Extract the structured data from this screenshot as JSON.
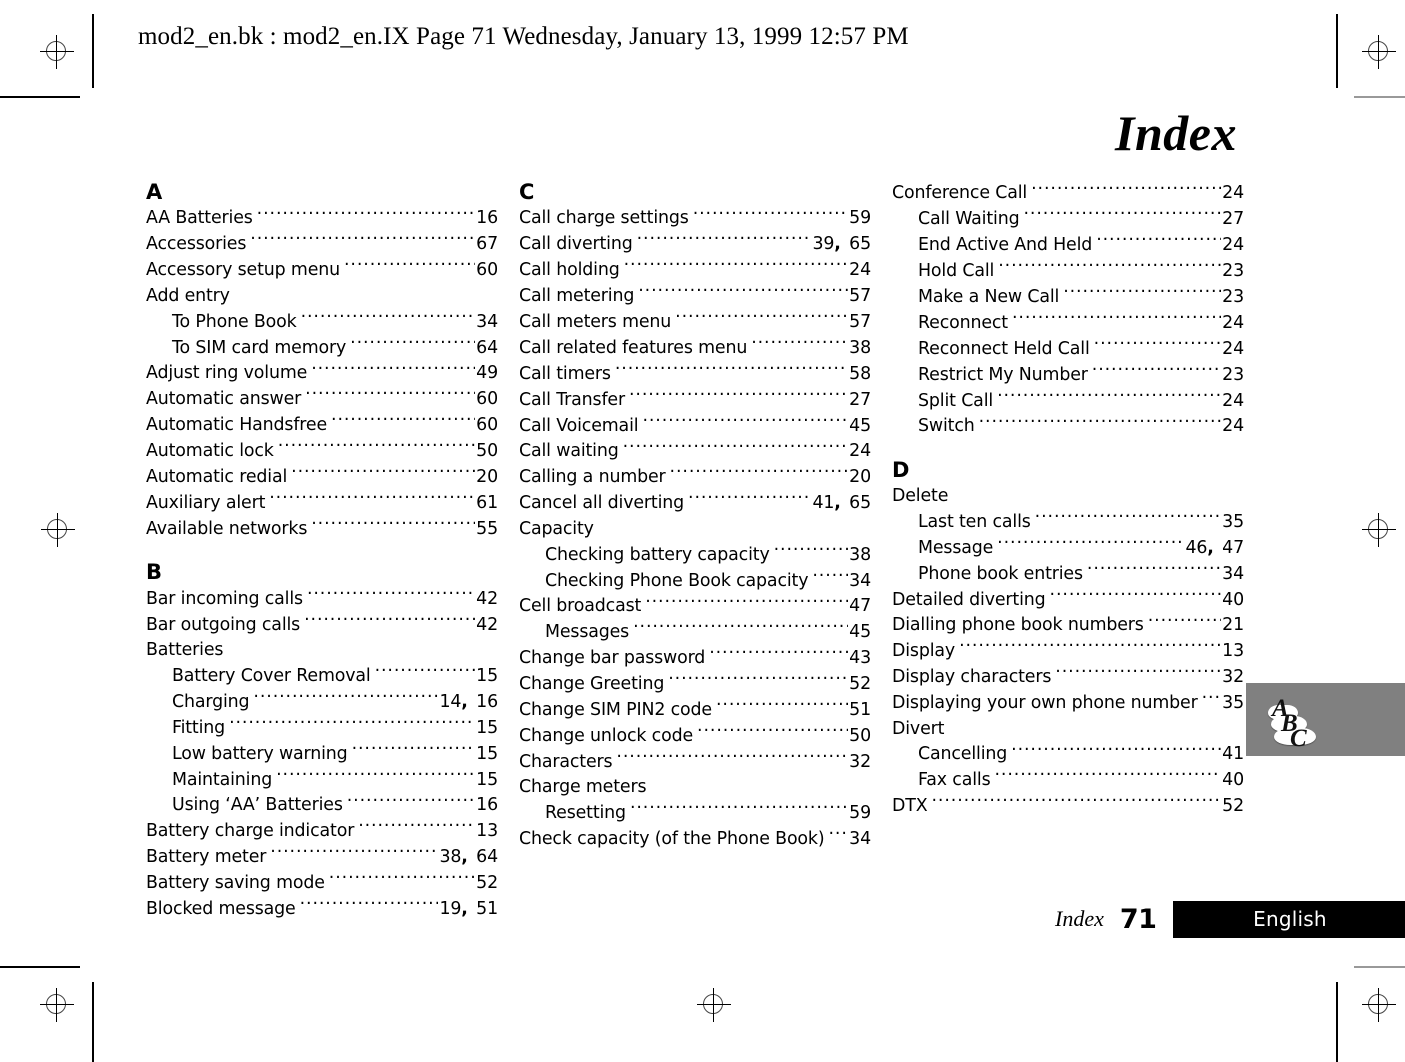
{
  "header": {
    "running_head": "mod2_en.bk : mod2_en.IX  Page 71  Wednesday, January 13, 1999  12:57 PM"
  },
  "page": {
    "title": "Index"
  },
  "columns": [
    {
      "sections": [
        {
          "letter": "A",
          "entries": [
            {
              "label": "AA Batteries",
              "pages": "16",
              "sub": false
            },
            {
              "label": "Accessories",
              "pages": "67",
              "sub": false
            },
            {
              "label": "Accessory setup menu",
              "pages": "60",
              "sub": false
            },
            {
              "label": "Add entry",
              "pages": "",
              "sub": false
            },
            {
              "label": "To Phone Book",
              "pages": "34",
              "sub": true
            },
            {
              "label": "To SIM card memory",
              "pages": "64",
              "sub": true
            },
            {
              "label": "Adjust ring volume",
              "pages": "49",
              "sub": false
            },
            {
              "label": "Automatic answer",
              "pages": "60",
              "sub": false
            },
            {
              "label": "Automatic Handsfree",
              "pages": "60",
              "sub": false
            },
            {
              "label": "Automatic lock",
              "pages": "50",
              "sub": false
            },
            {
              "label": "Automatic redial",
              "pages": "20",
              "sub": false
            },
            {
              "label": "Auxiliary alert",
              "pages": "61",
              "sub": false
            },
            {
              "label": "Available networks",
              "pages": "55",
              "sub": false
            }
          ]
        },
        {
          "letter": "B",
          "entries": [
            {
              "label": "Bar incoming calls",
              "pages": "42",
              "sub": false
            },
            {
              "label": "Bar outgoing calls",
              "pages": "42",
              "sub": false
            },
            {
              "label": "Batteries",
              "pages": "",
              "sub": false
            },
            {
              "label": "Battery Cover Removal",
              "pages": "15",
              "sub": true
            },
            {
              "label": "Charging",
              "pages": "14, 16",
              "sub": true
            },
            {
              "label": "Fitting",
              "pages": "15",
              "sub": true
            },
            {
              "label": "Low battery warning",
              "pages": "15",
              "sub": true
            },
            {
              "label": "Maintaining",
              "pages": "15",
              "sub": true
            },
            {
              "label": "Using ‘AA’ Batteries",
              "pages": "16",
              "sub": true
            },
            {
              "label": "Battery charge indicator",
              "pages": "13",
              "sub": false
            },
            {
              "label": "Battery meter",
              "pages": "38, 64",
              "sub": false
            },
            {
              "label": "Battery saving mode",
              "pages": "52",
              "sub": false
            },
            {
              "label": "Blocked message",
              "pages": "19, 51",
              "sub": false
            }
          ]
        }
      ]
    },
    {
      "sections": [
        {
          "letter": "C",
          "entries": [
            {
              "label": "Call charge settings",
              "pages": "59",
              "sub": false
            },
            {
              "label": "Call diverting",
              "pages": "39, 65",
              "sub": false
            },
            {
              "label": "Call holding",
              "pages": "24",
              "sub": false
            },
            {
              "label": "Call metering",
              "pages": "57",
              "sub": false
            },
            {
              "label": "Call meters menu",
              "pages": "57",
              "sub": false
            },
            {
              "label": "Call related features menu",
              "pages": "38",
              "sub": false
            },
            {
              "label": "Call timers",
              "pages": "58",
              "sub": false
            },
            {
              "label": "Call Transfer",
              "pages": "27",
              "sub": false
            },
            {
              "label": "Call Voicemail",
              "pages": "45",
              "sub": false
            },
            {
              "label": "Call waiting",
              "pages": "24",
              "sub": false
            },
            {
              "label": "Calling a number",
              "pages": "20",
              "sub": false
            },
            {
              "label": "Cancel all diverting",
              "pages": "41, 65",
              "sub": false
            },
            {
              "label": "Capacity",
              "pages": "",
              "sub": false
            },
            {
              "label": "Checking battery capacity",
              "pages": "38",
              "sub": true
            },
            {
              "label": "Checking Phone Book capacity",
              "pages": "34",
              "sub": true
            },
            {
              "label": "Cell broadcast",
              "pages": "47",
              "sub": false
            },
            {
              "label": "Messages",
              "pages": "45",
              "sub": true
            },
            {
              "label": "Change bar password",
              "pages": "43",
              "sub": false
            },
            {
              "label": "Change Greeting",
              "pages": "52",
              "sub": false
            },
            {
              "label": "Change SIM PIN2 code",
              "pages": "51",
              "sub": false
            },
            {
              "label": "Change unlock code",
              "pages": "50",
              "sub": false
            },
            {
              "label": "Characters",
              "pages": "32",
              "sub": false
            },
            {
              "label": "Charge meters",
              "pages": "",
              "sub": false
            },
            {
              "label": "Resetting",
              "pages": "59",
              "sub": true
            },
            {
              "label": "Check capacity (of the Phone Book)",
              "pages": "34",
              "sub": false
            }
          ]
        }
      ]
    },
    {
      "sections": [
        {
          "letter": "",
          "entries": [
            {
              "label": "Conference Call",
              "pages": "24",
              "sub": false
            },
            {
              "label": "Call Waiting",
              "pages": "27",
              "sub": true
            },
            {
              "label": "End Active And Held",
              "pages": "24",
              "sub": true
            },
            {
              "label": "Hold Call",
              "pages": "23",
              "sub": true
            },
            {
              "label": "Make a New Call",
              "pages": "23",
              "sub": true
            },
            {
              "label": "Reconnect",
              "pages": "24",
              "sub": true
            },
            {
              "label": "Reconnect Held Call",
              "pages": "24",
              "sub": true
            },
            {
              "label": "Restrict My Number",
              "pages": "23",
              "sub": true
            },
            {
              "label": "Split Call",
              "pages": "24",
              "sub": true
            },
            {
              "label": "Switch",
              "pages": "24",
              "sub": true
            }
          ]
        },
        {
          "letter": "D",
          "entries": [
            {
              "label": "Delete",
              "pages": "",
              "sub": false
            },
            {
              "label": "Last ten calls",
              "pages": "35",
              "sub": true
            },
            {
              "label": "Message",
              "pages": "46, 47",
              "sub": true
            },
            {
              "label": "Phone book entries",
              "pages": "34",
              "sub": true
            },
            {
              "label": "Detailed diverting",
              "pages": "40",
              "sub": false
            },
            {
              "label": "Dialling phone book numbers",
              "pages": "21",
              "sub": false
            },
            {
              "label": "Display",
              "pages": "13",
              "sub": false
            },
            {
              "label": "Display characters",
              "pages": "32",
              "sub": false
            },
            {
              "label": "Displaying your own phone number",
              "pages": "35",
              "sub": false
            },
            {
              "label": "Divert",
              "pages": "",
              "sub": false
            },
            {
              "label": "Cancelling",
              "pages": "41",
              "sub": true
            },
            {
              "label": "Fax calls",
              "pages": "40",
              "sub": true
            },
            {
              "label": "DTX",
              "pages": "52",
              "sub": false
            }
          ]
        }
      ]
    }
  ],
  "thumb_tab": {
    "letters": [
      "A",
      "B",
      "C"
    ],
    "background_color": "#808080"
  },
  "footer": {
    "section_label": "Index",
    "page_number": "71",
    "language": "English",
    "bar_color": "#000000",
    "bar_text_color": "#ffffff"
  }
}
